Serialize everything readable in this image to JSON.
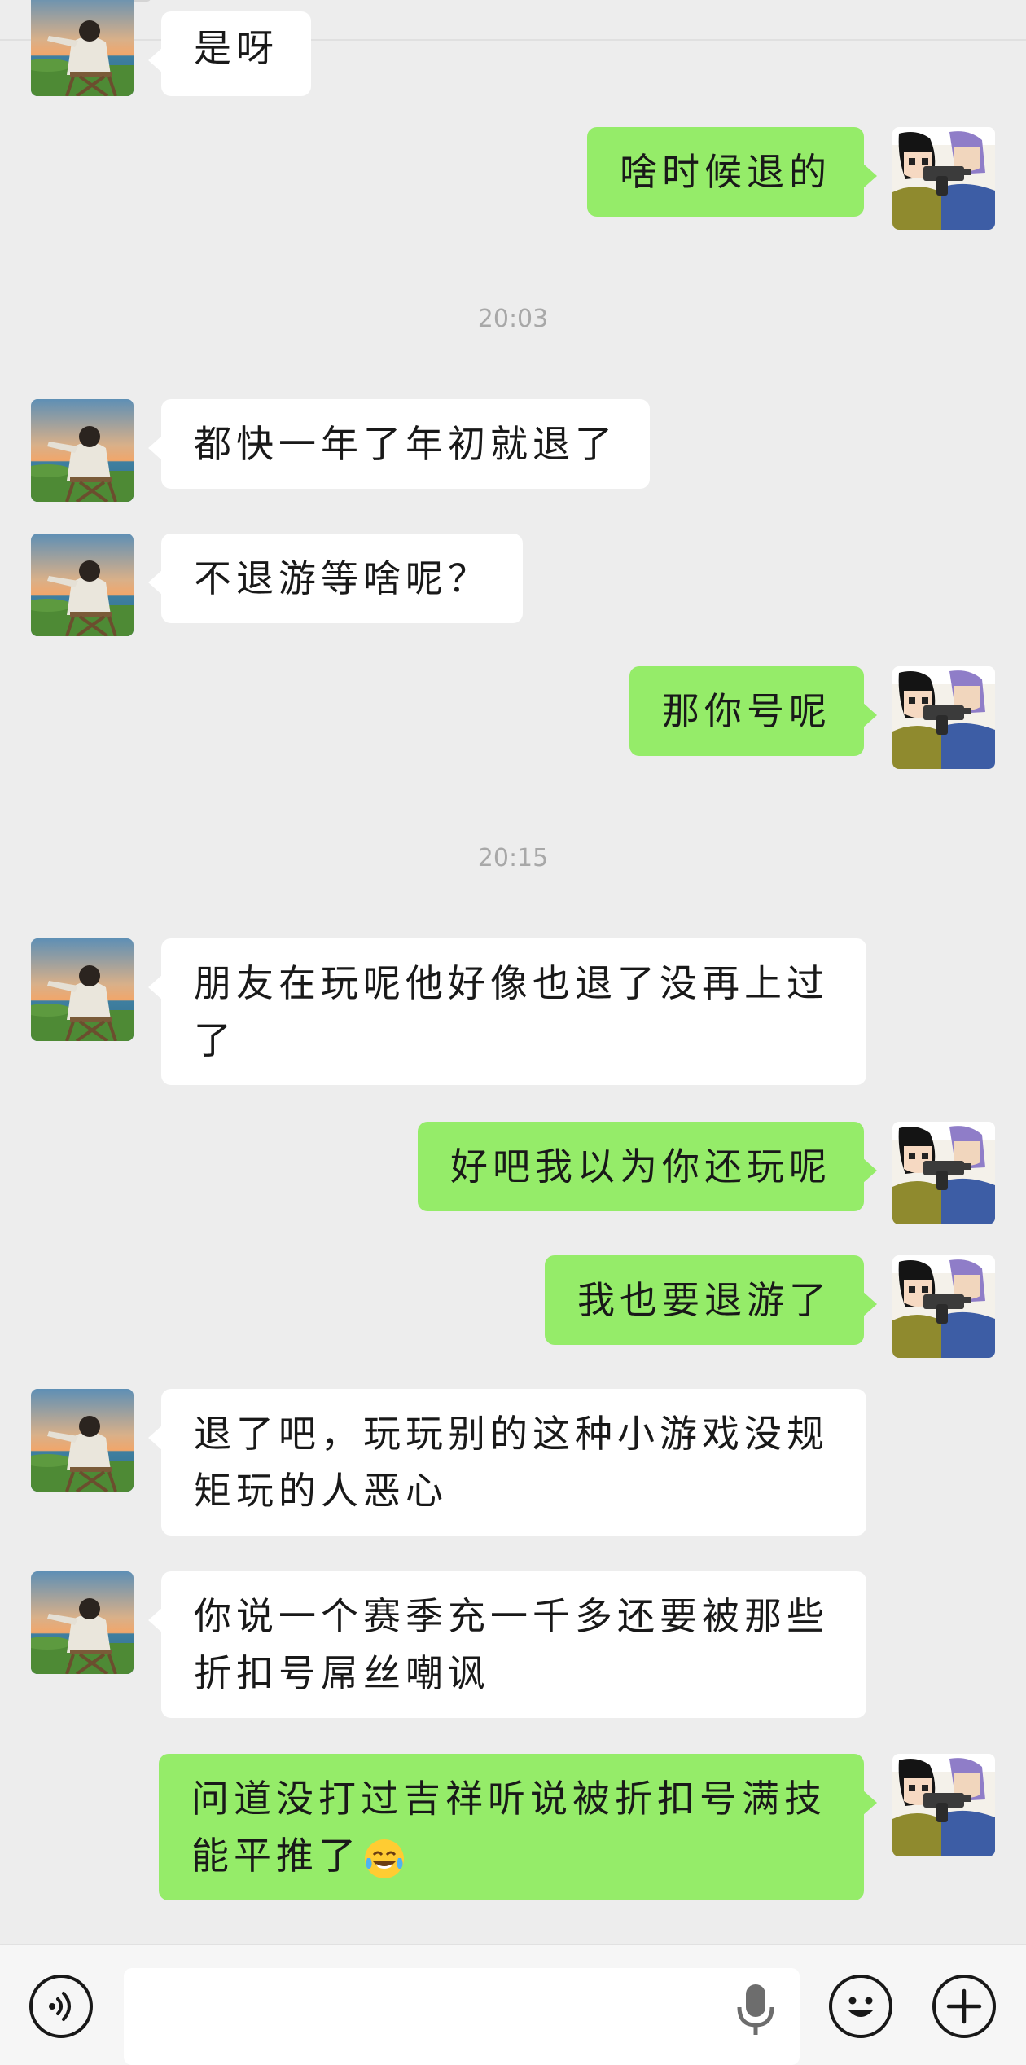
{
  "messages": [
    {
      "side": "friend",
      "text": "是呀"
    },
    {
      "side": "me",
      "text": "啥时候退的"
    },
    {
      "type": "time",
      "text": "20:03"
    },
    {
      "side": "friend",
      "text": "都快一年了年初就退了"
    },
    {
      "side": "friend",
      "text": "不退游等啥呢？"
    },
    {
      "side": "me",
      "text": "那你号呢"
    },
    {
      "type": "time",
      "text": "20:15"
    },
    {
      "side": "friend",
      "text": "朋友在玩呢他好像也退了没再上过了"
    },
    {
      "side": "me",
      "text": "好吧我以为你还玩呢"
    },
    {
      "side": "me",
      "text": "我也要退游了"
    },
    {
      "side": "friend",
      "text": "退了吧，玩玩别的这种小游戏没规矩玩的人恶心"
    },
    {
      "side": "friend",
      "text": "你说一个赛季充一千多还要被那些折扣号屌丝嘲讽"
    },
    {
      "side": "me",
      "text": "问道没打过吉祥听说被折扣号满技能平推了",
      "emoji": "tears-of-joy-emoji"
    }
  ],
  "input_bar": {
    "value": "",
    "placeholder": "",
    "left_icon": "voice-icon",
    "mic_icon": "microphone-icon",
    "emoji_icon": "smiley-icon",
    "plus_icon": "plus-icon"
  },
  "colors": {
    "background": "#ededed",
    "my_bubble": "#95ec69",
    "friend_bubble": "#ffffff",
    "timestamp_text": "#a8a8a8"
  }
}
